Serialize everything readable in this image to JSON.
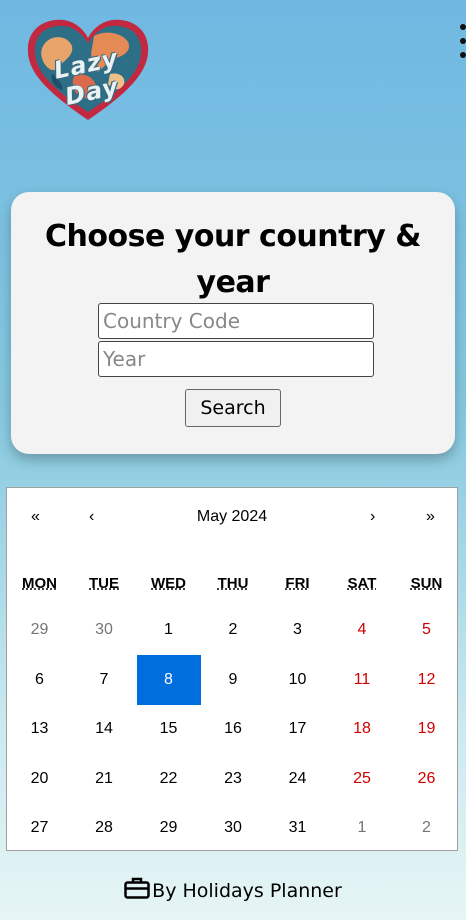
{
  "header": {
    "logo_text": "Lazy Day",
    "menu_icon": "more-vertical-icon"
  },
  "search_card": {
    "title": "Choose your country & year",
    "country_placeholder": "Country Code",
    "year_placeholder": "Year",
    "search_label": "Search"
  },
  "calendar": {
    "month_label": "May 2024",
    "nav": {
      "prev_year": "«",
      "prev_month": "‹",
      "next_month": "›",
      "next_year": "»"
    },
    "weekdays": [
      "MON",
      "TUE",
      "WED",
      "THU",
      "FRI",
      "SAT",
      "SUN"
    ],
    "weeks": [
      [
        "29",
        "30",
        "1",
        "2",
        "3",
        "4",
        "5"
      ],
      [
        "6",
        "7",
        "8",
        "9",
        "10",
        "11",
        "12"
      ],
      [
        "13",
        "14",
        "15",
        "16",
        "17",
        "18",
        "19"
      ],
      [
        "20",
        "21",
        "22",
        "23",
        "24",
        "25",
        "26"
      ],
      [
        "27",
        "28",
        "29",
        "30",
        "31",
        "1",
        "2"
      ]
    ],
    "selected_day": "8",
    "colors": {
      "selected": "#006edc",
      "weekend": "#d10000",
      "other_month": "#757575"
    }
  },
  "footer": {
    "text": "By Holidays Planner",
    "icon": "briefcase-icon"
  }
}
